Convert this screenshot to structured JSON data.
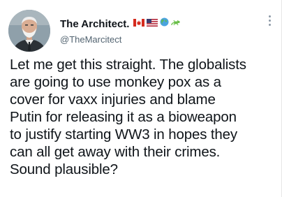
{
  "tweet": {
    "author_name": "The Architect.",
    "author_handle": "@TheMarcitect",
    "name_emojis": [
      "canada-flag-icon",
      "usa-flag-icon",
      "globe-icon",
      "lizard-icon"
    ],
    "text_lines": [
      "Let me get this straight. The globalists",
      "are going to use monkey pox as a",
      "cover for vaxx injuries and blame",
      "Putin for releasing it as a bioweapon",
      "to justify starting WW3 in hopes they",
      "can all get away with their crimes.",
      "Sound plausible?"
    ]
  }
}
